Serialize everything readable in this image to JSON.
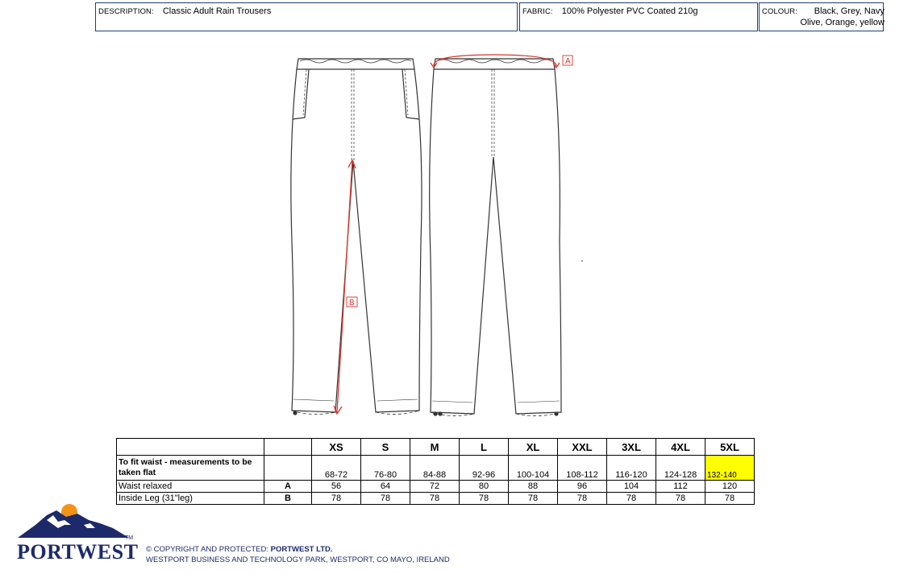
{
  "header": {
    "description_label": "DESCRIPTION:",
    "description_value": "Classic Adult Rain Trousers",
    "fabric_label": "FABRIC:",
    "fabric_value": "100% Polyester PVC Coated 210g",
    "colour_label": "COLOUR:",
    "colour_line1": "Black, Grey, Navy",
    "colour_line2": "Olive, Orange, yellow"
  },
  "diagram": {
    "marker_a": "A",
    "marker_b": "B",
    "line_color": "#333333",
    "measure_color": "#d9342b"
  },
  "size_table": {
    "sizes": [
      "XS",
      "S",
      "M",
      "L",
      "XL",
      "XXL",
      "3XL",
      "4XL",
      "5XL"
    ],
    "fit_label": "To fit waist - measurements to be taken flat",
    "fit_values": [
      "68-72",
      "76-80",
      "84-88",
      "92-96",
      "100-104",
      "108-112",
      "116-120",
      "124-128",
      "132-140"
    ],
    "highlight_color": "#ffff00",
    "rows": [
      {
        "label": "Waist relaxed",
        "code": "A",
        "values": [
          "56",
          "64",
          "72",
          "80",
          "88",
          "96",
          "104",
          "112",
          "120"
        ]
      },
      {
        "label": "Inside Leg (31\"leg)",
        "code": "B",
        "values": [
          "78",
          "78",
          "78",
          "78",
          "78",
          "78",
          "78",
          "78",
          "78"
        ]
      }
    ]
  },
  "footer": {
    "brand": "PORTWEST",
    "trademark": "TM",
    "copyright_prefix": "© COPYRIGHT AND PROTECTED: ",
    "company": "PORTWEST LTD.",
    "address": "WESTPORT BUSINESS AND TECHNOLOGY PARK, WESTPORT, CO MAYO, IRELAND"
  }
}
